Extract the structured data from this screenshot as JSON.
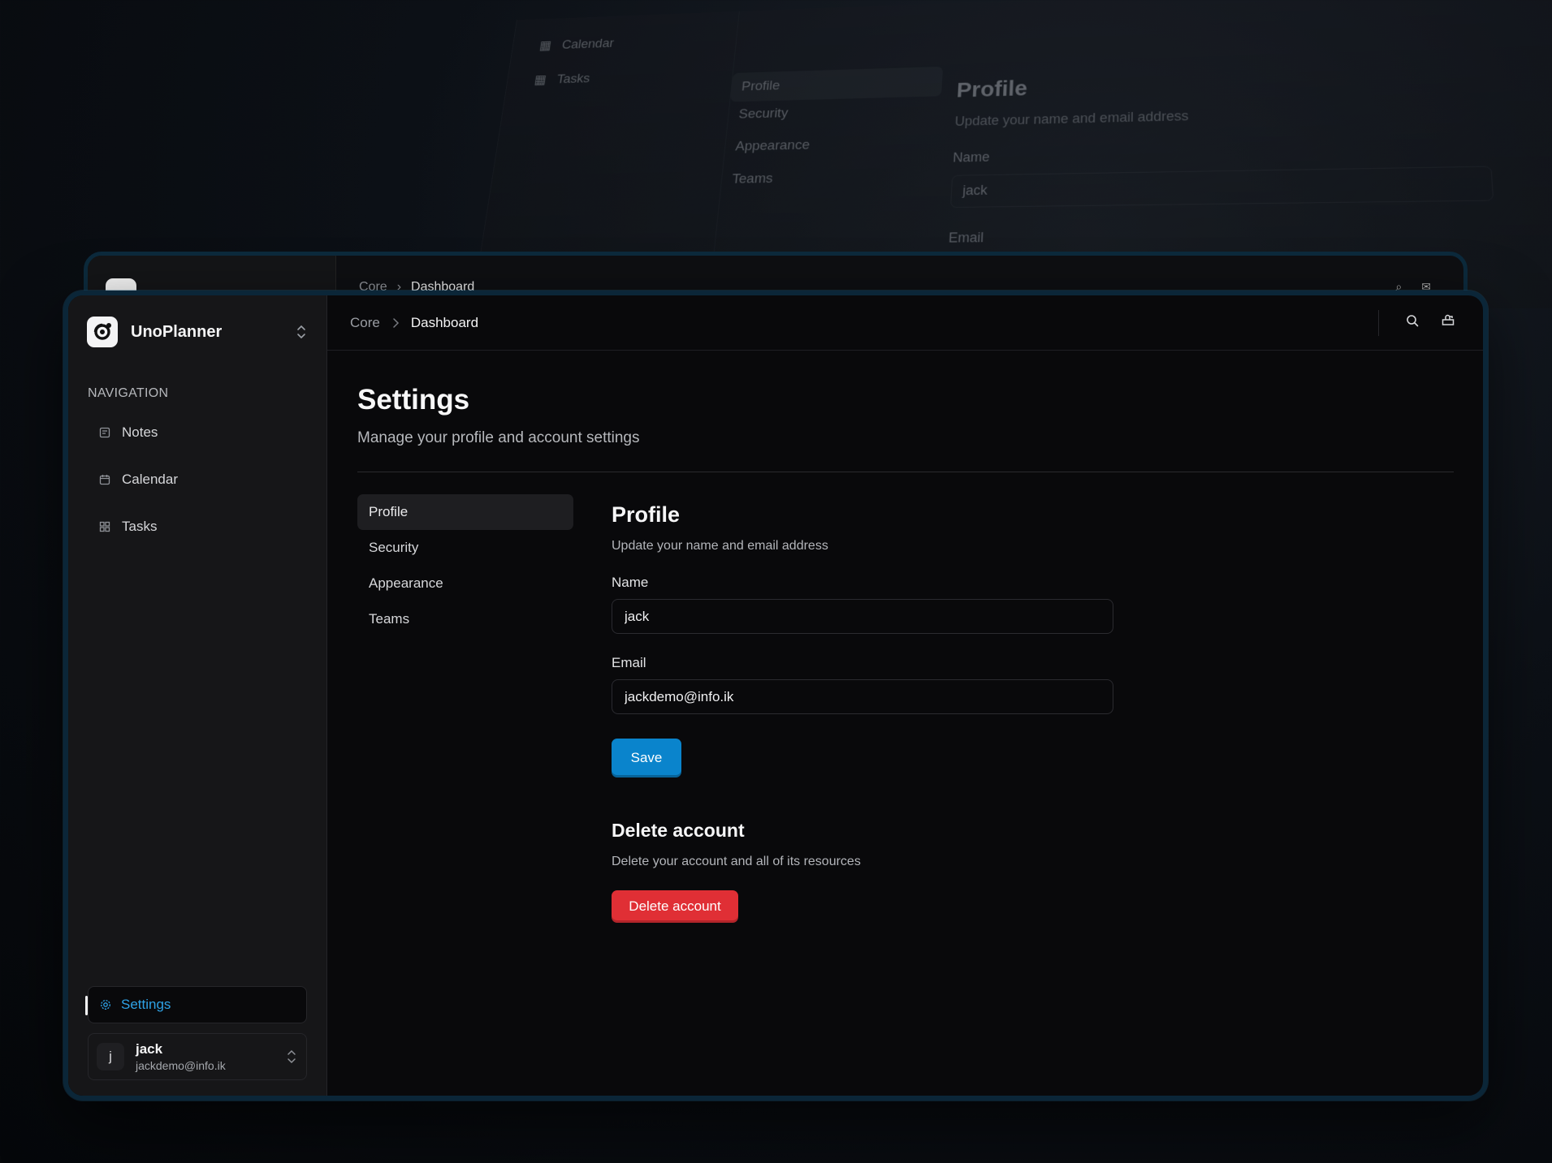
{
  "ghost": {
    "nav_calendar": "Calendar",
    "nav_tasks": "Tasks",
    "menu": [
      "Profile",
      "Security",
      "Appearance",
      "Teams"
    ],
    "title": "Profile",
    "subtitle": "Update your name and email address",
    "name_label": "Name",
    "name_value": "jack",
    "email_label": "Email"
  },
  "back_window": {
    "crumb_root": "Core",
    "crumb_current": "Dashboard"
  },
  "app": {
    "name": "UnoPlanner"
  },
  "sidebar": {
    "heading": "NAVIGATION",
    "items": [
      {
        "label": "Notes",
        "icon": "notes-icon"
      },
      {
        "label": "Calendar",
        "icon": "calendar-icon"
      },
      {
        "label": "Tasks",
        "icon": "tasks-icon"
      }
    ],
    "settings_label": "Settings",
    "user": {
      "initial": "j",
      "name": "jack",
      "email": "jackdemo@info.ik"
    }
  },
  "topbar": {
    "crumb_root": "Core",
    "crumb_current": "Dashboard",
    "icons": [
      "search-icon",
      "notification-icon"
    ]
  },
  "page": {
    "title": "Settings",
    "subtitle": "Manage your profile and account settings"
  },
  "settings_menu": {
    "items": [
      "Profile",
      "Security",
      "Appearance",
      "Teams"
    ],
    "active": "Profile"
  },
  "profile": {
    "title": "Profile",
    "subtitle": "Update your name and email address",
    "name_label": "Name",
    "name_value": "jack",
    "email_label": "Email",
    "email_value": "jackdemo@info.ik",
    "save_label": "Save"
  },
  "delete": {
    "title": "Delete account",
    "subtitle": "Delete your account and all of its resources",
    "button_label": "Delete account"
  },
  "colors": {
    "accent": "#0a84cc",
    "danger": "#e02f35",
    "active_settings": "#2ea2e6",
    "frame": "#0b2638"
  }
}
